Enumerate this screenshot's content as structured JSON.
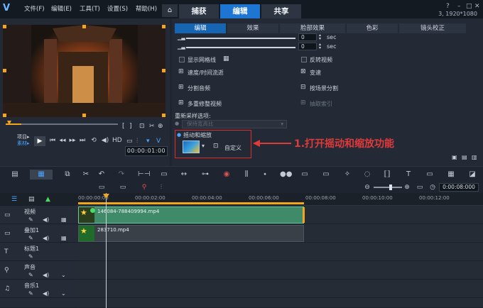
{
  "app": {
    "logo": "V",
    "menu": [
      "文件(F)",
      "编辑(E)",
      "工具(T)",
      "设置(S)",
      "帮助(H)"
    ],
    "main_tabs": [
      "捕获",
      "编辑",
      "共享"
    ],
    "active_tab": "编辑",
    "resolution": "3, 1920*1080"
  },
  "preview": {
    "mode_labels": [
      "项目▸",
      "素材▸"
    ],
    "timecode": "00:00:01:00"
  },
  "options": {
    "subtabs": [
      "编辑",
      "效果",
      "脸部效果",
      "色彩",
      "镜头校正"
    ],
    "active_subtab": "编辑",
    "numbox_1": "0",
    "numbox_2": "0",
    "sec_label": "sec",
    "show_grid": "显示网格线",
    "reverse_video": "反转视频",
    "speed_time": "速度/时间流逝",
    "speed_change": "变速",
    "split_audio": "分割音频",
    "split_by_scene": "按场景分割",
    "multi_trim": "多重修整视频",
    "extract_index": "抽取索引",
    "resample_label": "重新采样选项:",
    "resample_value": "保持宽高比",
    "pan_zoom_label": "摇动和缩放",
    "custom_label": "自定义"
  },
  "annotation": "1.打开摇动和缩放功能",
  "timeline": {
    "time_display": "0:00:08:000",
    "ruler": [
      "00:00:00:00",
      "00:00:02:00",
      "00:00:04:00",
      "00:00:06:00",
      "00:00:08:00",
      "00:00:10:00",
      "00:00:12:00"
    ],
    "tracks": [
      "视频",
      "叠加1",
      "标题1",
      "声音",
      "音乐1"
    ],
    "clip_video": "146084-788409994.mp4",
    "clip_overlay": "283710.mp4"
  },
  "colors": {
    "accent": "#1f76d2",
    "highlight": "#e02a2a",
    "clip_green": "#3f8a68"
  }
}
